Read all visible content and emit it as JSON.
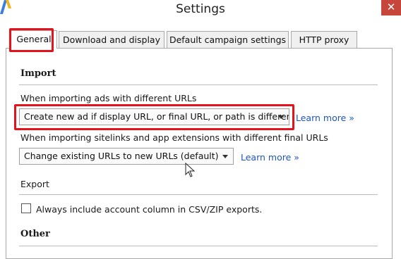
{
  "window": {
    "title": "Settings",
    "close_glyph": "✕"
  },
  "tabs": [
    {
      "label": "General",
      "active": true
    },
    {
      "label": "Download and display",
      "active": false
    },
    {
      "label": "Default campaign settings",
      "active": false
    },
    {
      "label": "HTTP proxy",
      "active": false
    }
  ],
  "import": {
    "heading": "Import",
    "ads_label": "When importing ads with different URLs",
    "ads_selected": "Create new ad if display URL, or final URL, or path is different",
    "sitelinks_label": "When importing sitelinks and app extensions with different final URLs",
    "sitelinks_selected": "Change existing URLs to new URLs (default)",
    "learn_more": "Learn more »"
  },
  "export": {
    "heading": "Export",
    "checkbox_label": "Always include account column in CSV/ZIP exports.",
    "checked": false
  },
  "other": {
    "heading": "Other"
  },
  "colors": {
    "highlight": "#e3121b",
    "link": "#1f55c0",
    "close": "#c7463b"
  }
}
